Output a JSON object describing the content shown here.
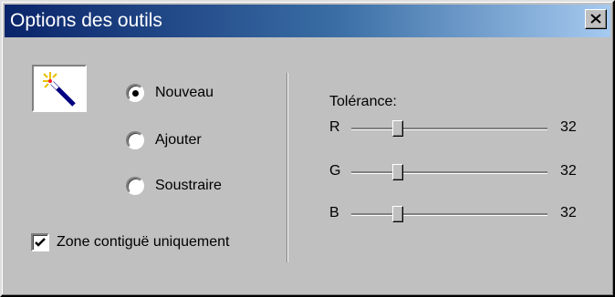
{
  "window": {
    "title": "Options des outils",
    "close_icon": "close-x-icon"
  },
  "tool": {
    "icon": "magic-wand-icon"
  },
  "selection_mode": {
    "options": [
      {
        "label": "Nouveau",
        "selected": true
      },
      {
        "label": "Ajouter",
        "selected": false
      },
      {
        "label": "Soustraire",
        "selected": false
      }
    ]
  },
  "contiguous": {
    "label": "Zone contiguë uniquement",
    "checked": true
  },
  "tolerance": {
    "label": "Tolérance:",
    "max": 255,
    "channels": [
      {
        "name": "R",
        "value": "32"
      },
      {
        "name": "G",
        "value": "32"
      },
      {
        "name": "B",
        "value": "32"
      }
    ]
  }
}
